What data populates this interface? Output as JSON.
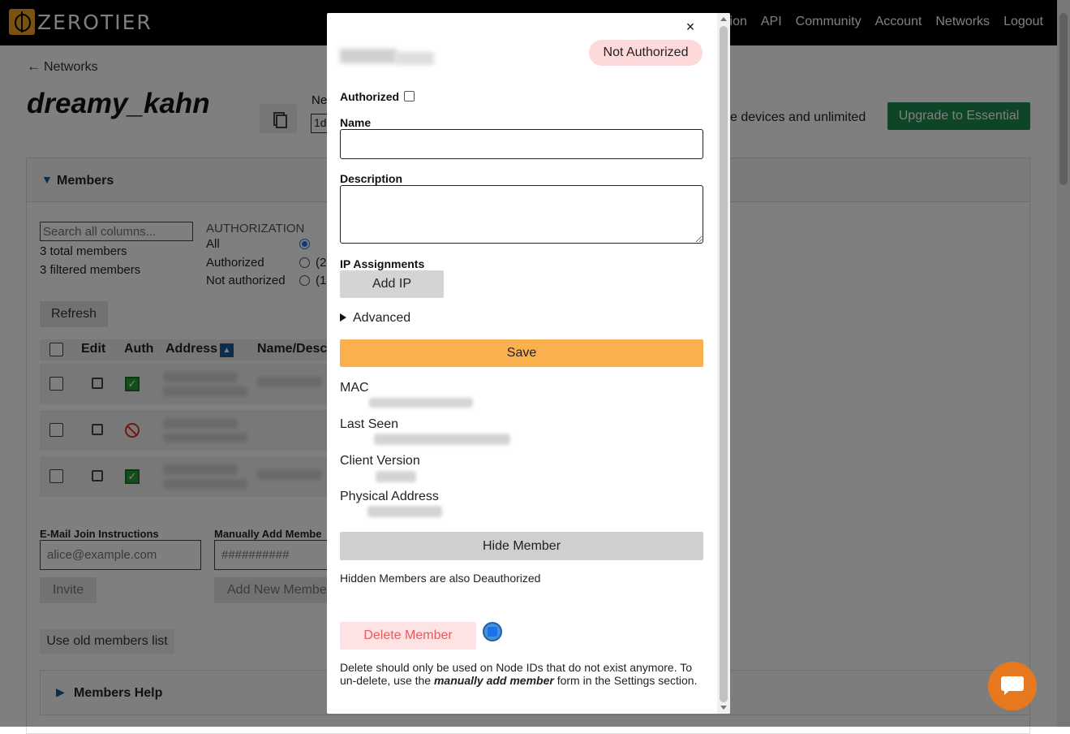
{
  "header": {
    "logo_text": "ZEROTIER",
    "nav": [
      "tion",
      "API",
      "Community",
      "Account",
      "Networks",
      "Logout"
    ]
  },
  "page": {
    "back_label": "Networks",
    "network_name": "dreamy_kahn",
    "network_id_label": "Ne",
    "network_id_value": "1d",
    "upgrade_text": "e devices and unlimited",
    "upgrade_button": "Upgrade to Essential"
  },
  "members": {
    "title": "Members",
    "search_placeholder": "Search all columns...",
    "total": "3 total members",
    "filtered": "3 filtered members",
    "auth_filter": {
      "title": "AUTHORIZATION",
      "options": [
        {
          "label": "All",
          "count": "",
          "selected": true
        },
        {
          "label": "Authorized",
          "count": "(2",
          "selected": false
        },
        {
          "label": "Not authorized",
          "count": "(1",
          "selected": false
        }
      ]
    },
    "refresh_label": "Refresh",
    "columns": [
      "Edit",
      "Auth",
      "Address",
      "Name/Desc"
    ],
    "rows": [
      {
        "authorized": true
      },
      {
        "authorized": false
      },
      {
        "authorized": true
      }
    ],
    "email_label": "E-Mail Join Instructions",
    "email_placeholder": "alice@example.com",
    "manual_label": "Manually Add Membe",
    "manual_placeholder": "##########",
    "invite_label": "Invite",
    "add_new_label": "Add New Membe",
    "old_list_label": "Use old members list",
    "help_title": "Members Help"
  },
  "modal": {
    "close_glyph": "×",
    "status": "Not Authorized",
    "authorized_label": "Authorized",
    "name_label": "Name",
    "name_value": "",
    "description_label": "Description",
    "description_value": "",
    "ip_label": "IP Assignments",
    "add_ip_label": "Add IP",
    "advanced_label": "Advanced",
    "save_label": "Save",
    "mac_label": "MAC",
    "last_seen_label": "Last Seen",
    "client_version_label": "Client Version",
    "physical_address_label": "Physical Address",
    "hide_label": "Hide Member",
    "hidden_note": "Hidden Members are also Deauthorized",
    "delete_label": "Delete Member",
    "delete_note_pre": "Delete should only be used on Node IDs that do not exist anymore. To un-delete, use the ",
    "delete_note_em": "manually add member",
    "delete_note_post": " form in the Settings section."
  },
  "colors": {
    "save": "#fbb050",
    "status_pill": "#fdd9d9",
    "upgrade": "#1b8a4c",
    "chat": "#e8781e"
  }
}
